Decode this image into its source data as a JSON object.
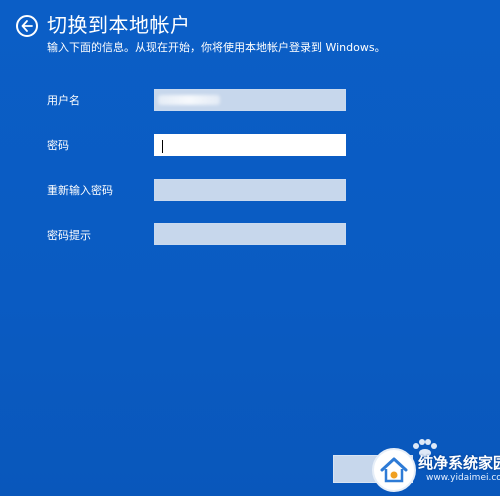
{
  "header": {
    "title": "切换到本地帐户",
    "subtitle": "输入下面的信息。从现在开始，你将使用本地帐户登录到 Windows。"
  },
  "form": {
    "username": {
      "label": "用户名",
      "value": ""
    },
    "password": {
      "label": "密码",
      "value": ""
    },
    "reenter_password": {
      "label": "重新输入密码",
      "value": ""
    },
    "password_hint": {
      "label": "密码提示",
      "value": ""
    }
  },
  "watermark": {
    "brand": "纯净系统家园",
    "url": "www.yidaimei.com"
  },
  "icons": {
    "back": "back-arrow-circle-icon"
  },
  "colors": {
    "background": "#0a5bc2",
    "input_bg": "#c7d7ec",
    "active_input_bg": "#ffffff"
  }
}
